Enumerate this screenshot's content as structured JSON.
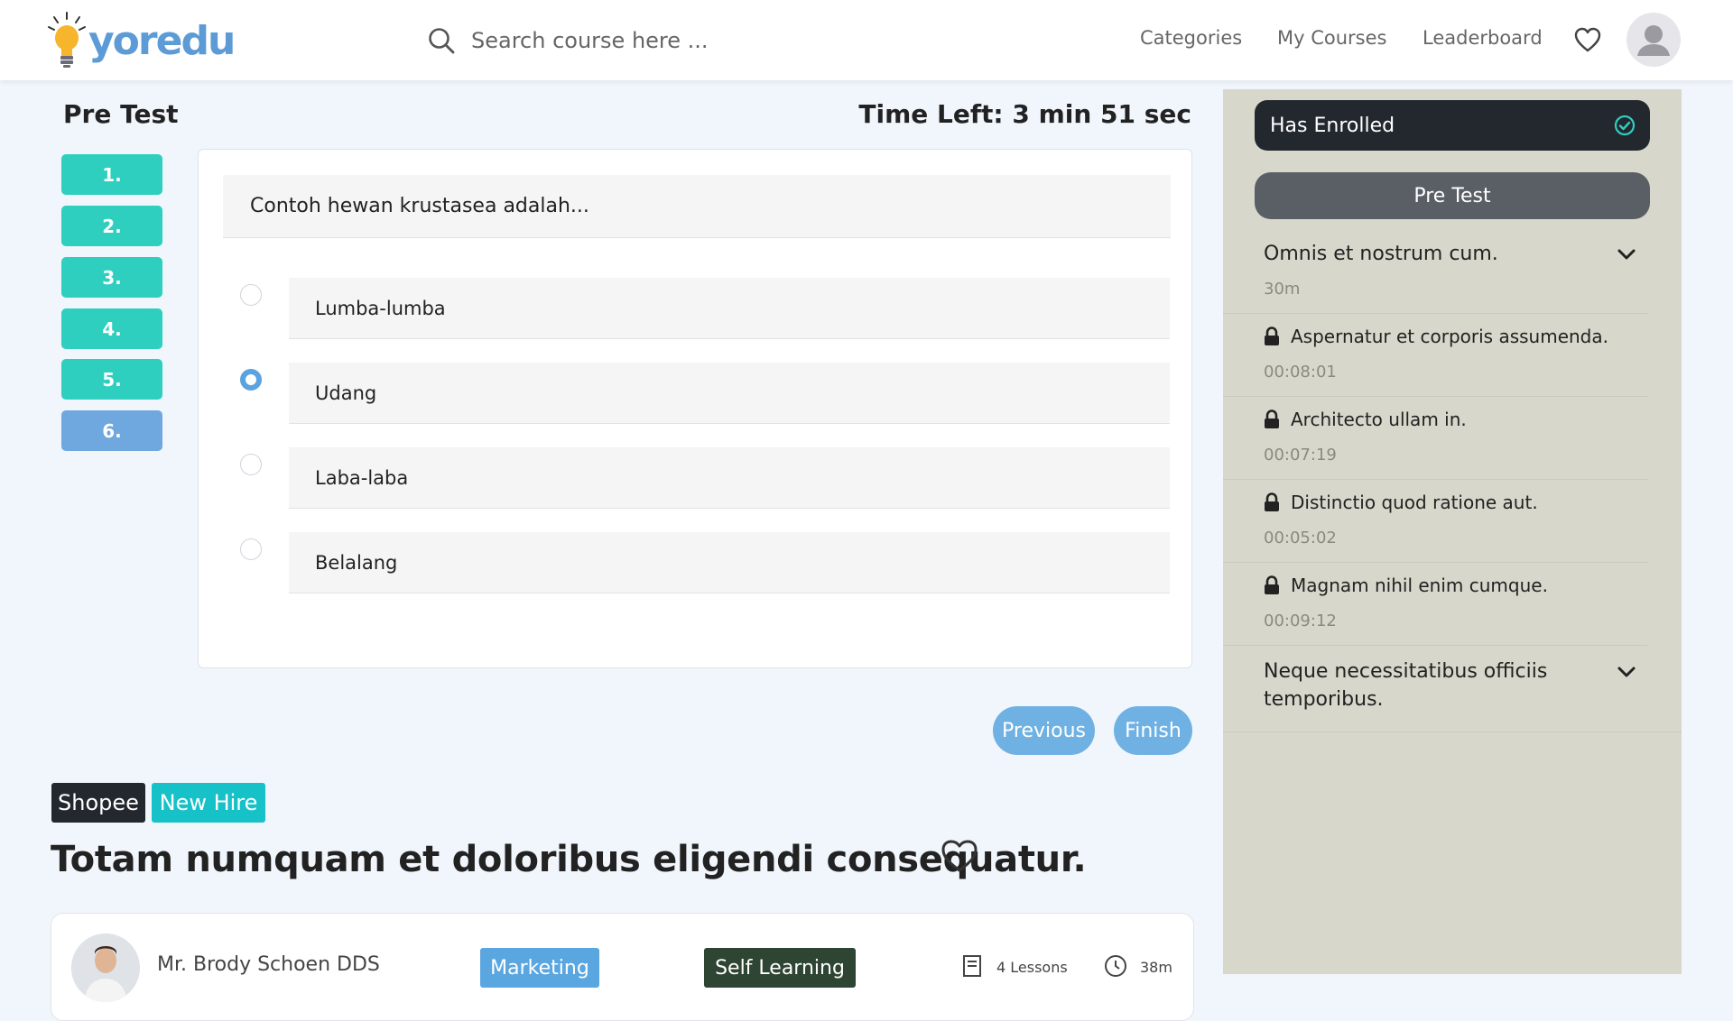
{
  "header": {
    "logo_text": "yoredu",
    "search_placeholder": "Search course here ...",
    "nav": [
      "Categories",
      "My Courses",
      "Leaderboard"
    ]
  },
  "quiz": {
    "title": "Pre Test",
    "time_left": "Time Left: 3 min 51 sec",
    "question_numbers": [
      "1.",
      "2.",
      "3.",
      "4.",
      "5.",
      "6."
    ],
    "active_question_index": 5,
    "question": "Contoh hewan krustasea adalah...",
    "options": [
      "Lumba-lumba",
      "Udang",
      "Laba-laba",
      "Belalang"
    ],
    "selected_option_index": 1,
    "prev_label": "Previous",
    "finish_label": "Finish"
  },
  "course": {
    "tags": [
      "Shopee",
      "New Hire"
    ],
    "title": "Totam numquam et doloribus eligendi consequatur.",
    "instructor": "Mr. Brody Schoen DDS",
    "category": "Marketing",
    "type": "Self Learning",
    "lessons": "4 Lessons",
    "duration": "38m"
  },
  "sidebar": {
    "enrolled_label": "Has Enrolled",
    "pretest_label": "Pre Test",
    "section1": {
      "title": "Omnis et nostrum cum.",
      "duration": "30m"
    },
    "lessons": [
      {
        "title": "Aspernatur et corporis assumenda.",
        "duration": "00:08:01"
      },
      {
        "title": "Architecto ullam in.",
        "duration": "00:07:19"
      },
      {
        "title": "Distinctio quod ratione aut.",
        "duration": "00:05:02"
      },
      {
        "title": "Magnam nihil enim cumque.",
        "duration": "00:09:12"
      }
    ],
    "section2": {
      "title_line1": "Neque necessitatibus officiis",
      "title_line2": "temporibus."
    }
  },
  "colors": {
    "brand": "#5d9bd6",
    "question_number": "#2ecfbf",
    "question_number_active": "#6fa8de",
    "pill_button": "#6fb1e2",
    "sidebar_bg": "#d7d7cb",
    "enrolled_bg": "#23282f",
    "tag_dark": "#23282f",
    "tag_teal": "#17c1c8",
    "chip_marketing": "#5aa6e0",
    "chip_self_learning": "#2f4533"
  }
}
